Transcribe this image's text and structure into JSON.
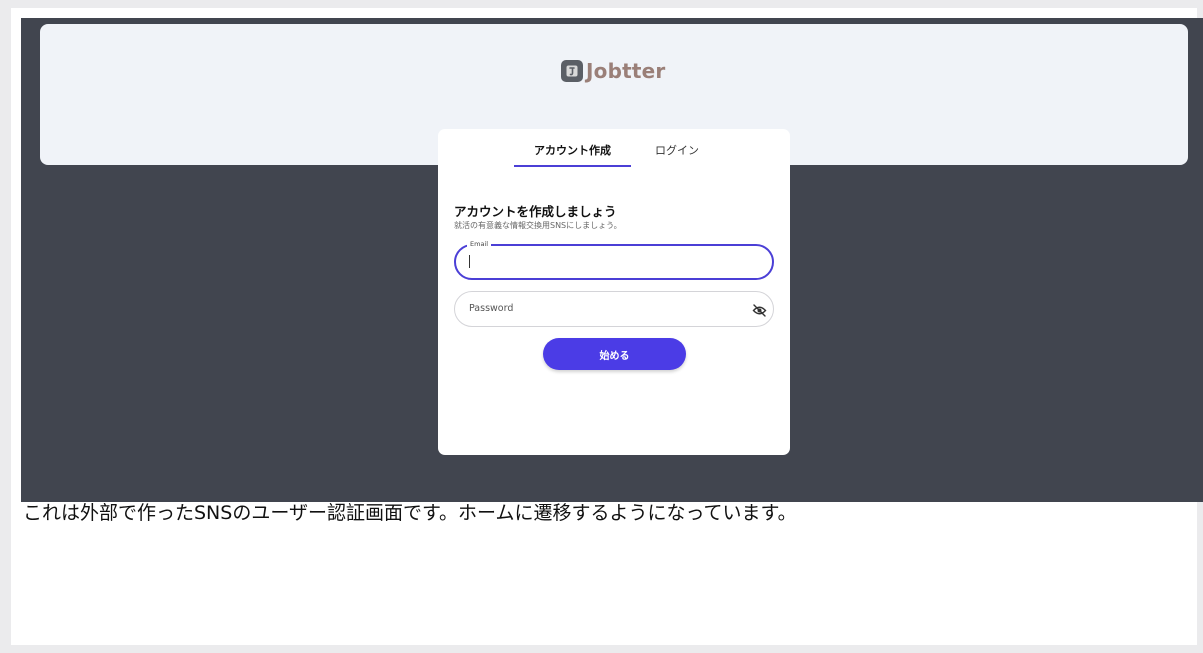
{
  "app": {
    "brand_name": "Jobtter",
    "logo_icon": "jobtter-logo-icon"
  },
  "auth": {
    "tabs": [
      {
        "label": "アカウント作成",
        "active": true
      },
      {
        "label": "ログイン",
        "active": false
      }
    ],
    "heading": "アカウントを作成しましょう",
    "subheading": "就活の有意義な情報交換用SNSにしましょう。",
    "email": {
      "label": "Email",
      "value": "",
      "focused": true
    },
    "password": {
      "placeholder": "Password",
      "toggle_icon": "eye-off-icon"
    },
    "submit_label": "始める"
  },
  "caption": "これは外部で作ったSNSのユーザー認証画面です。ホームに遷移するようになっています。",
  "colors": {
    "accent": "#4b3ce6",
    "backdrop": "#41454f",
    "header_panel": "#f0f3f8",
    "brand_text": "#9a7f78"
  }
}
